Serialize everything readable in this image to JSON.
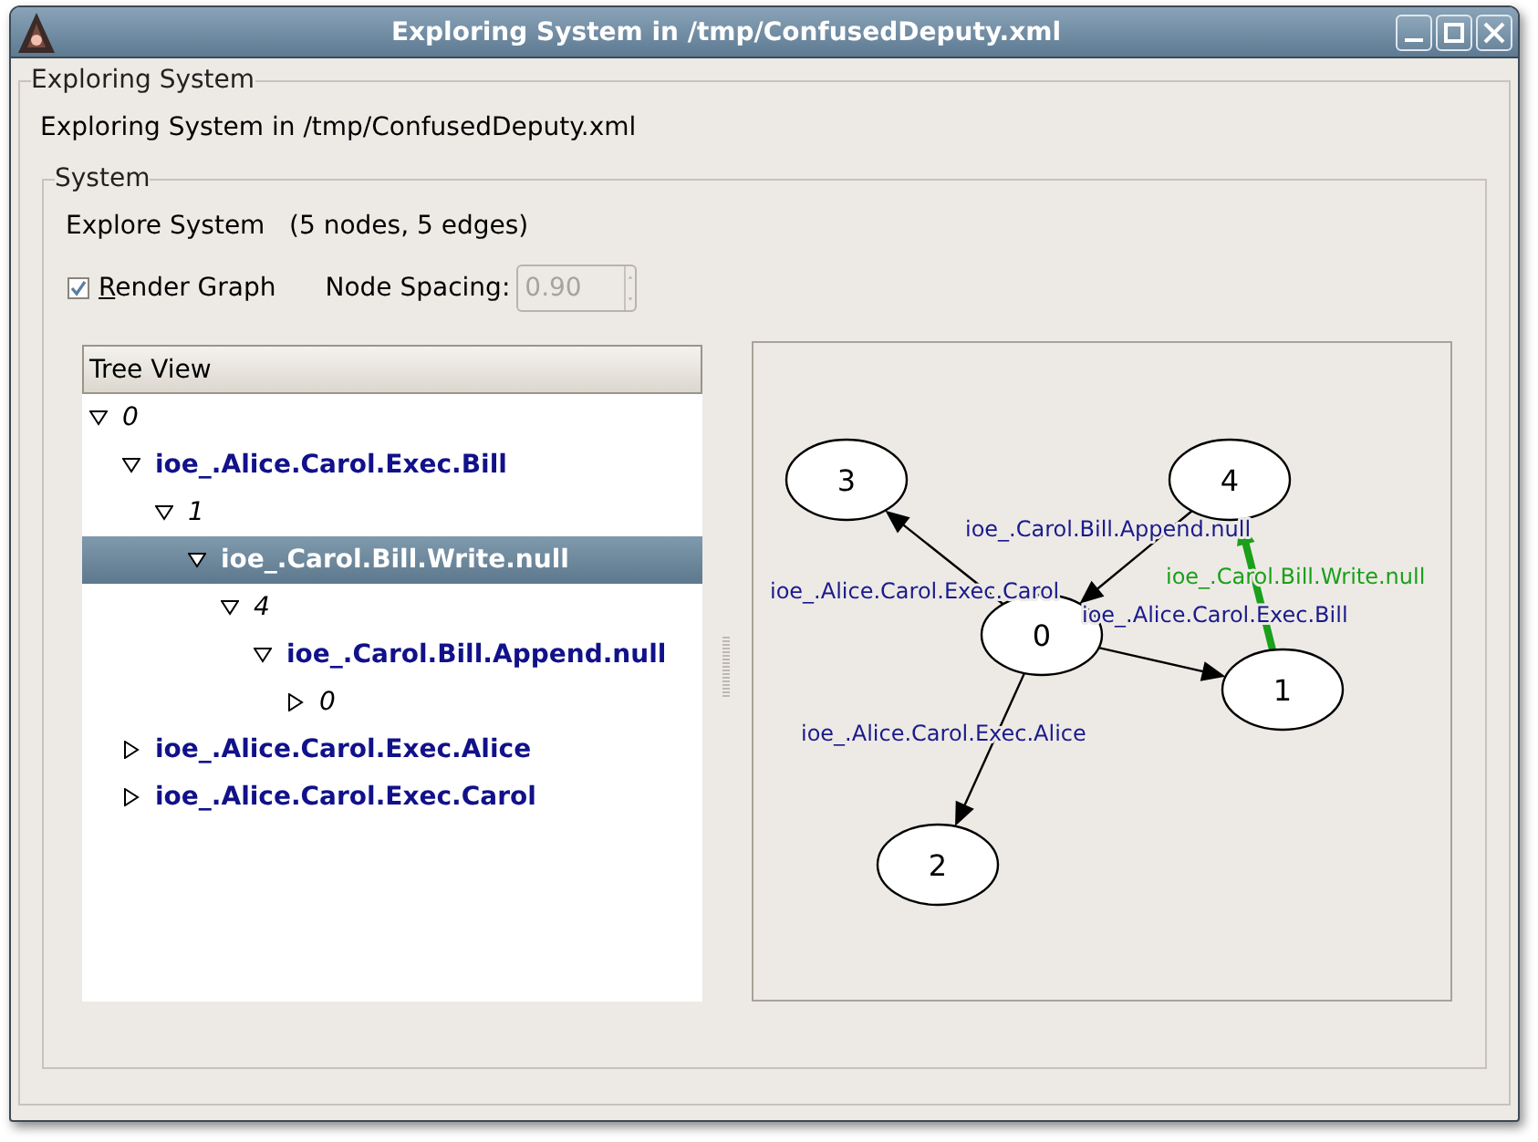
{
  "window": {
    "title": "Exploring System in /tmp/ConfusedDeputy.xml"
  },
  "outer_group": {
    "legend": "Exploring System",
    "heading": "Exploring System in /tmp/ConfusedDeputy.xml"
  },
  "system_group": {
    "legend": "System",
    "summary": "Explore System   (5 nodes, 5 edges)"
  },
  "render_graph": {
    "label": "Render Graph",
    "checked": true
  },
  "node_spacing": {
    "label": "Node Spacing:",
    "value": "0.90",
    "disabled": true
  },
  "tree": {
    "header": "Tree View",
    "items": [
      {
        "kind": "node",
        "label": "0",
        "expanded": true,
        "selected": false,
        "children": [
          {
            "kind": "edge",
            "label": "ioe_.Alice.Carol.Exec.Bill",
            "expanded": true,
            "selected": false,
            "children": [
              {
                "kind": "node",
                "label": "1",
                "expanded": true,
                "selected": false,
                "children": [
                  {
                    "kind": "edge",
                    "label": "ioe_.Carol.Bill.Write.null",
                    "expanded": true,
                    "selected": true,
                    "children": [
                      {
                        "kind": "node",
                        "label": "4",
                        "expanded": true,
                        "selected": false,
                        "children": [
                          {
                            "kind": "edge",
                            "label": "ioe_.Carol.Bill.Append.null",
                            "expanded": true,
                            "selected": false,
                            "children": [
                              {
                                "kind": "node",
                                "label": "0",
                                "expanded": false,
                                "selected": false
                              }
                            ]
                          }
                        ]
                      }
                    ]
                  }
                ]
              }
            ]
          },
          {
            "kind": "edge",
            "label": "ioe_.Alice.Carol.Exec.Alice",
            "expanded": false,
            "selected": false
          },
          {
            "kind": "edge",
            "label": "ioe_.Alice.Carol.Exec.Carol",
            "expanded": false,
            "selected": false
          }
        ]
      }
    ]
  },
  "graph": {
    "nodes": [
      {
        "label": "0"
      },
      {
        "label": "1"
      },
      {
        "label": "2"
      },
      {
        "label": "3"
      },
      {
        "label": "4"
      }
    ],
    "edges": [
      {
        "label": "ioe_.Alice.Carol.Exec.Carol",
        "highlighted": false
      },
      {
        "label": "ioe_.Carol.Bill.Append.null",
        "highlighted": false
      },
      {
        "label": "ioe_.Carol.Bill.Write.null",
        "highlighted": true
      },
      {
        "label": "ioe_.Alice.Carol.Exec.Bill",
        "highlighted": false
      },
      {
        "label": "ioe_.Alice.Carol.Exec.Alice",
        "highlighted": false
      }
    ]
  }
}
